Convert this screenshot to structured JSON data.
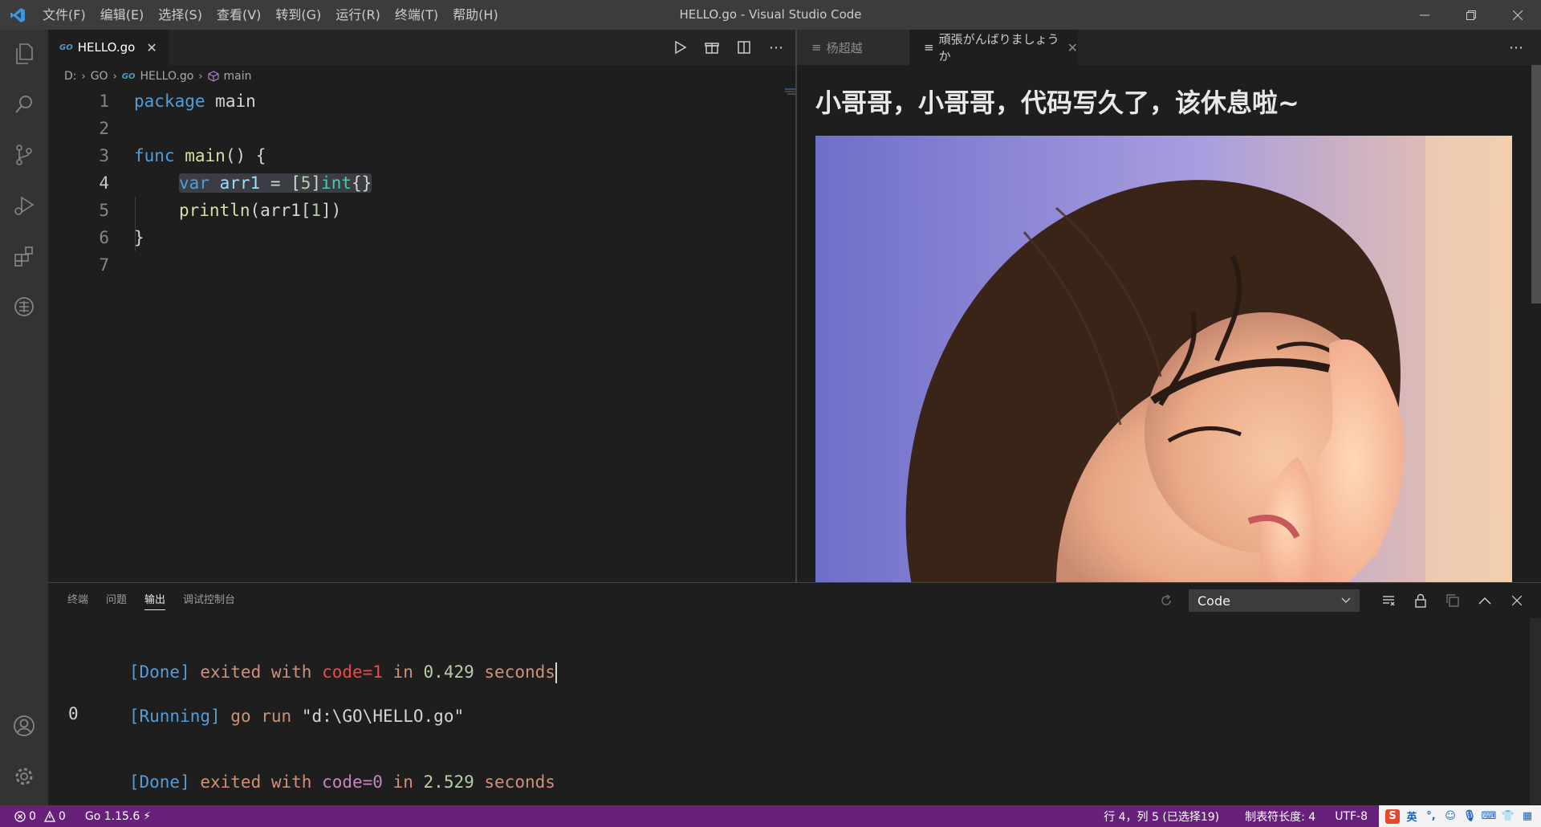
{
  "window": {
    "title": "HELLO.go - Visual Studio Code",
    "menus": [
      "文件(F)",
      "编辑(E)",
      "选择(S)",
      "查看(V)",
      "转到(G)",
      "运行(R)",
      "终端(T)",
      "帮助(H)"
    ]
  },
  "activity_icons": [
    "files-icon",
    "search-icon",
    "source-control-icon",
    "run-debug-icon",
    "extensions-icon",
    "remote-explorer-icon",
    "account-icon",
    "settings-gear-icon"
  ],
  "editor": {
    "tab_label": "HELLO.go",
    "tab_badge": "GO",
    "breadcrumb": [
      "D:",
      "GO",
      "HELLO.go",
      "main"
    ],
    "line_numbers": [
      "1",
      "2",
      "3",
      "4",
      "5",
      "6",
      "7"
    ],
    "current_line": "4",
    "code": {
      "l1_kw": "package",
      "l1_name": "main",
      "l3_kw": "func",
      "l3_fn": "main",
      "l3_rest": "() {",
      "l4_kw": "var",
      "l4_var": "arr1",
      "l4_eq": " = ",
      "l4_open": "[",
      "l4_num": "5",
      "l4_close": "]",
      "l4_type": "int",
      "l4_brace": "{}",
      "l5_fn": "println",
      "l5_open": "(arr1[",
      "l5_num": "1",
      "l5_close": "])",
      "l6": "}"
    }
  },
  "webview": {
    "tabs": [
      "杨超越",
      "頑張がんばりましょうか"
    ],
    "heading": "小哥哥，小哥哥，代码写久了，该休息啦~"
  },
  "panel": {
    "tabs": [
      "终端",
      "问题",
      "输出",
      "调试控制台"
    ],
    "active_tab": "输出",
    "output_channel": "Code",
    "output": {
      "l1": {
        "tag": "[Done]",
        "t1": " exited with ",
        "code": "code=1",
        "t2": " in ",
        "time": "0.429",
        "t3": " seconds"
      },
      "l2": {
        "tag": "[Running]",
        "t1": " go run ",
        "path": "\"d:\\GO\\HELLO.go\""
      },
      "l3": "0",
      "l4": {
        "tag": "[Done]",
        "t1": " exited with ",
        "code": "code=0",
        "t2": " in ",
        "time": "2.529",
        "t3": " seconds"
      }
    }
  },
  "statusbar": {
    "errors": "0",
    "warnings": "0",
    "go_version": "Go 1.15.6",
    "position": "行 4，列 5 (已选择19)",
    "tab_size": "制表符长度: 4",
    "encoding": "UTF-8",
    "ime_lang": "英"
  },
  "colors": {
    "statusbar": "#68217a",
    "titlebar": "#3c3c3c",
    "activitybar": "#333333",
    "editor_bg": "#1e1e1e"
  }
}
